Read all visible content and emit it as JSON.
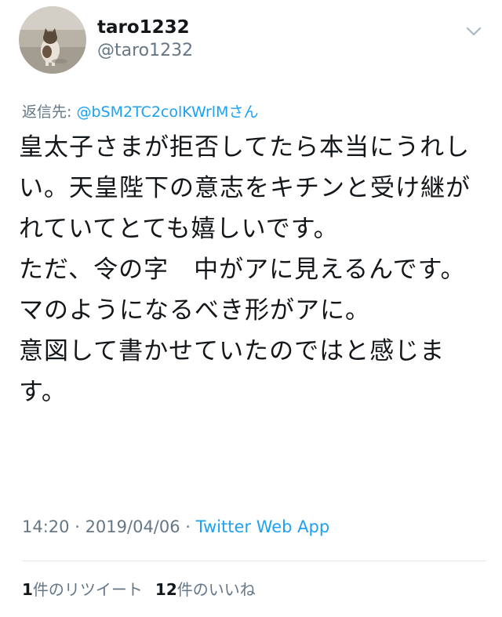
{
  "header": {
    "display_name": "taro1232",
    "handle": "@taro1232"
  },
  "reply": {
    "prefix": "返信先: ",
    "mention": "@bSM2TC2colKWrlMさん"
  },
  "tweet": {
    "text": "皇太子さまが拒否してたら本当にうれしい。天皇陛下の意志をキチンと受け継がれていてとても嬉しいです。\nただ、令の字　中がアに見えるんです。\nマのようになるべき形がアに。\n意図して書かせていたのではと感じます。"
  },
  "meta": {
    "time": "14:20",
    "separator1": " · ",
    "date": "2019/04/06",
    "separator2": " · ",
    "source": "Twitter Web App"
  },
  "stats": {
    "retweets_count": "1",
    "retweets_label": "件のリツイート",
    "likes_count": "12",
    "likes_label": "件のいいね"
  },
  "colors": {
    "text": "#14171a",
    "secondary": "#657786",
    "link": "#1da1f2",
    "divider": "#e1e8ed"
  },
  "icons": {
    "avatar": "cat-photo-avatar",
    "menu": "chevron-down-icon"
  }
}
